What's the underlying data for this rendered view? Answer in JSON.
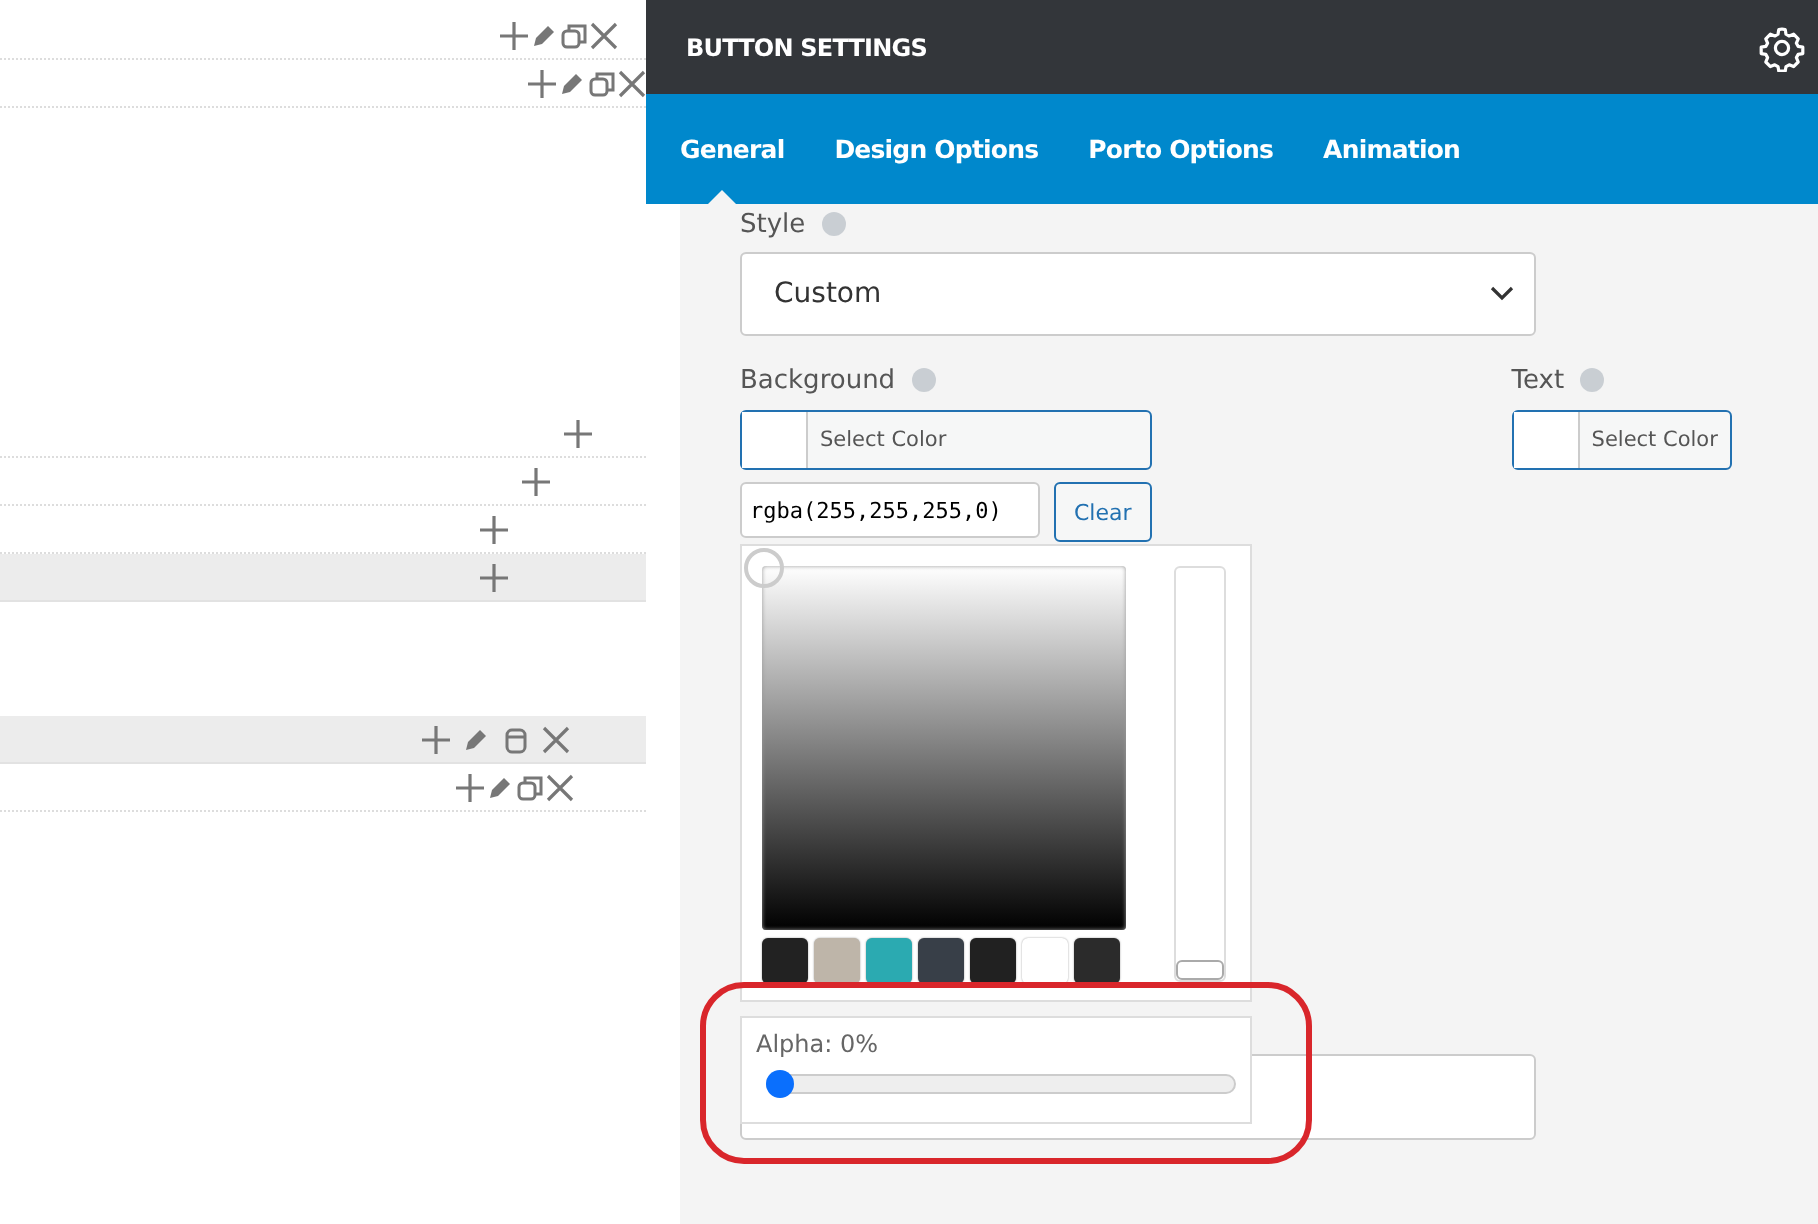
{
  "canvas_rows": [
    {
      "kind": "full",
      "highlighted": false
    },
    {
      "kind": "full",
      "highlighted": false
    },
    {
      "kind": "gap"
    },
    {
      "kind": "add",
      "highlighted": false
    },
    {
      "kind": "add",
      "highlighted": false
    },
    {
      "kind": "add",
      "highlighted": false
    },
    {
      "kind": "add",
      "highlighted": true
    },
    {
      "kind": "gap"
    },
    {
      "kind": "full",
      "highlighted": true
    },
    {
      "kind": "full",
      "highlighted": false
    }
  ],
  "panel": {
    "title": "BUTTON SETTINGS",
    "tabs": [
      {
        "label": "General",
        "selected": true
      },
      {
        "label": "Design Options",
        "selected": false
      },
      {
        "label": "Porto Options",
        "selected": false
      },
      {
        "label": "Animation",
        "selected": false
      }
    ],
    "style_label": "Style",
    "style_value": "Custom",
    "background": {
      "label": "Background",
      "button": "Select Color",
      "value": "rgba(255,255,255,0)",
      "clear": "Clear"
    },
    "text_color": {
      "label": "Text",
      "button": "Select Color"
    },
    "swatches": [
      {
        "color": "#222222"
      },
      {
        "color": "#beb5a9"
      },
      {
        "color": "#2baab1"
      },
      {
        "color": "#383f48"
      },
      {
        "color": "#212121"
      },
      {
        "color": "#ffffff"
      },
      {
        "color": "#2b2b2b"
      }
    ],
    "hue": {
      "level": 0
    },
    "alpha": {
      "label": "Alpha: 0%",
      "level": 0
    }
  }
}
